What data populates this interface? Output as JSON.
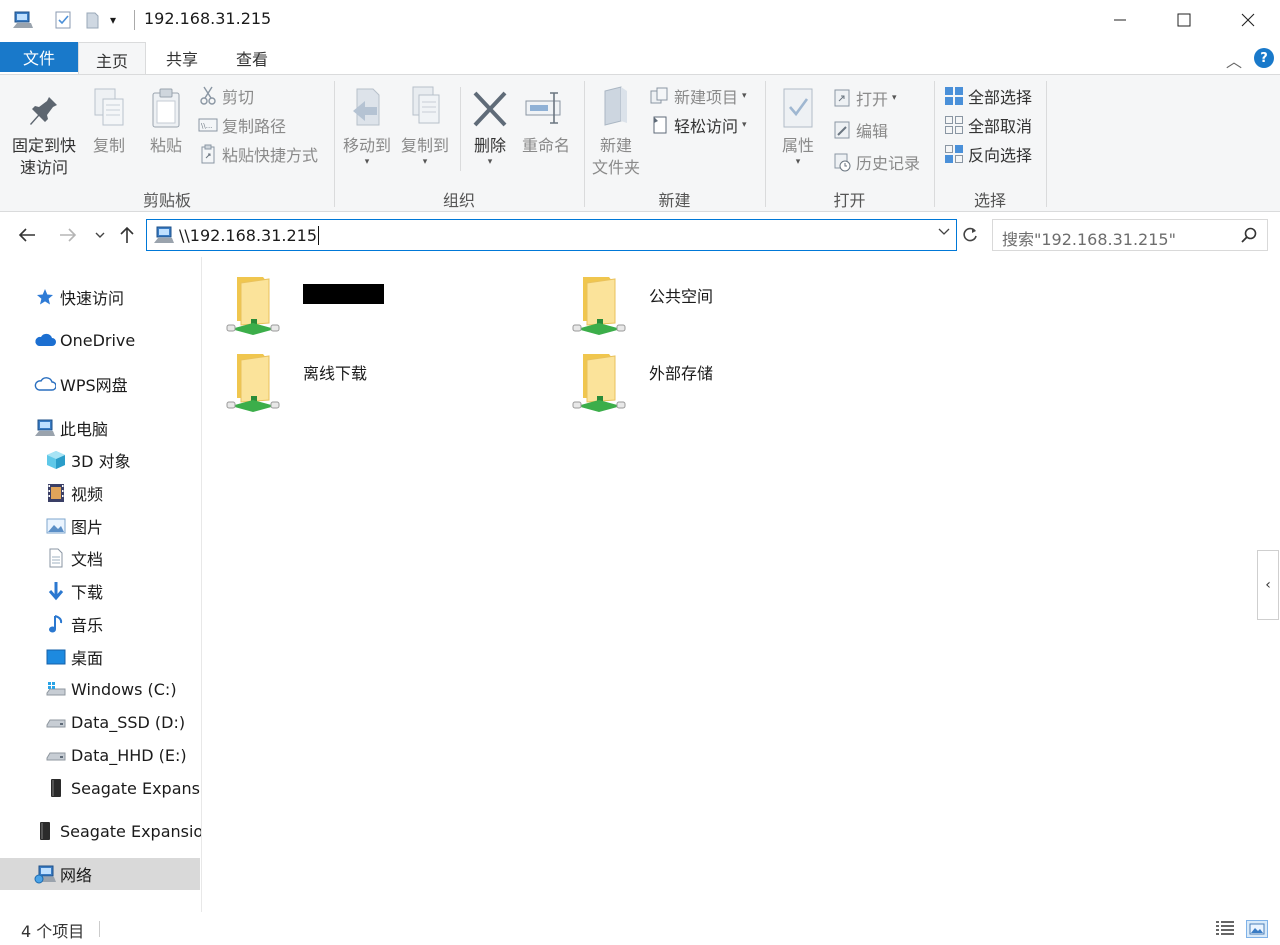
{
  "window": {
    "title": "192.168.31.215"
  },
  "ribbon_tabs": {
    "file": "文件",
    "home": "主页",
    "share": "共享",
    "view": "查看"
  },
  "ribbon": {
    "clipboard": {
      "pin": "固定到快\n速访问",
      "pin_line1": "固定到快",
      "pin_line2": "速访问",
      "copy": "复制",
      "paste": "粘贴",
      "cut": "剪切",
      "copy_path": "复制路径",
      "paste_shortcut": "粘贴快捷方式",
      "group": "剪贴板"
    },
    "organize": {
      "move_to": "移动到",
      "copy_to": "复制到",
      "delete": "删除",
      "rename": "重命名",
      "group": "组织"
    },
    "new": {
      "new_folder_line1": "新建",
      "new_folder_line2": "文件夹",
      "new_item": "新建项目",
      "easy_access": "轻松访问",
      "group": "新建"
    },
    "open": {
      "properties": "属性",
      "open": "打开",
      "edit": "编辑",
      "history": "历史记录",
      "group": "打开"
    },
    "select": {
      "select_all": "全部选择",
      "select_none": "全部取消",
      "invert": "反向选择",
      "group": "选择"
    }
  },
  "address": {
    "path": "\\\\192.168.31.215",
    "search_placeholder": "搜索\"192.168.31.215\""
  },
  "sidebar": {
    "items": [
      {
        "label": "快速访问",
        "icon": "star-icon"
      },
      {
        "label": "OneDrive",
        "icon": "cloud-icon"
      },
      {
        "label": "WPS网盘",
        "icon": "cloud-outline-icon"
      },
      {
        "label": "此电脑",
        "icon": "computer-icon"
      },
      {
        "label": "3D 对象",
        "icon": "cube-icon"
      },
      {
        "label": "视频",
        "icon": "film-icon"
      },
      {
        "label": "图片",
        "icon": "picture-icon"
      },
      {
        "label": "文档",
        "icon": "document-icon"
      },
      {
        "label": "下载",
        "icon": "download-icon"
      },
      {
        "label": "音乐",
        "icon": "music-icon"
      },
      {
        "label": "桌面",
        "icon": "desktop-icon"
      },
      {
        "label": "Windows (C:)",
        "icon": "drive-windows-icon"
      },
      {
        "label": "Data_SSD (D:)",
        "icon": "drive-icon"
      },
      {
        "label": "Data_HHD (E:)",
        "icon": "drive-icon"
      },
      {
        "label": "Seagate Expansion",
        "icon": "external-drive-icon"
      },
      {
        "label": "Seagate Expansion",
        "icon": "external-drive-icon"
      },
      {
        "label": "网络",
        "icon": "network-icon"
      }
    ]
  },
  "content": {
    "folders": [
      {
        "name": "",
        "redacted": true
      },
      {
        "name": "公共空间"
      },
      {
        "name": "离线下载"
      },
      {
        "name": "外部存储"
      }
    ]
  },
  "status": {
    "count": "4 个项目"
  }
}
